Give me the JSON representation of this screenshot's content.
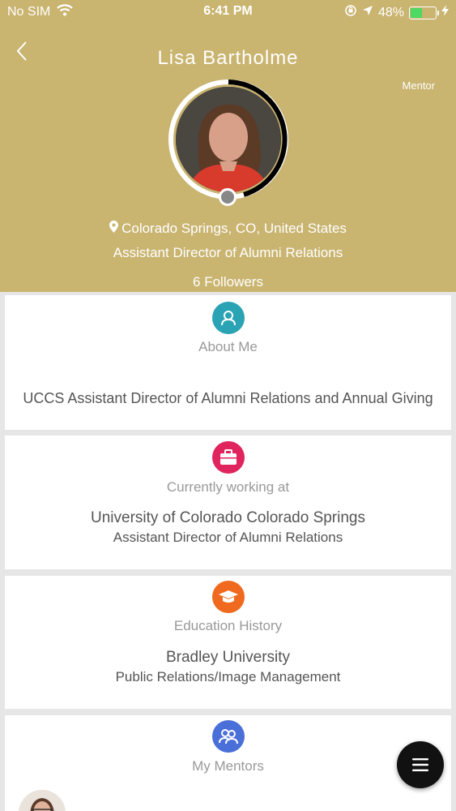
{
  "status_bar": {
    "carrier": "No SIM",
    "time": "6:41 PM",
    "battery_percent": "48%",
    "battery_level": 0.48,
    "battery_color": "#4cd964"
  },
  "header": {
    "background_color": "#c9b470",
    "name": "Lisa  Bartholme",
    "role_badge": "Mentor",
    "location": "Colorado Springs, CO, United States",
    "job_title": "Assistant Director of Alumni Relations",
    "followers": "6 Followers",
    "icons": [
      "back-chevron-icon",
      "location-pin-icon",
      "wifi-icon",
      "rotation-lock-icon",
      "location-arrow-icon",
      "charging-bolt-icon"
    ]
  },
  "sections": {
    "about": {
      "title": "About Me",
      "text": "UCCS Assistant Director of Alumni Relations and Annual Giving",
      "icon": "user-icon",
      "icon_color": "#2aa3b4"
    },
    "work": {
      "title": "Currently working at",
      "organization": "University of Colorado Colorado Springs",
      "position": "Assistant Director of Alumni Relations",
      "icon": "briefcase-icon",
      "icon_color": "#e0245e"
    },
    "education": {
      "title": "Education History",
      "school": "Bradley University",
      "degree": "Public Relations/Image Management",
      "icon": "graduation-cap-icon",
      "icon_color": "#ef6a1f"
    },
    "mentors": {
      "title": "My Mentors",
      "icon": "people-icon",
      "icon_color": "#4a6fd8"
    }
  },
  "fab": {
    "icon": "menu-icon"
  }
}
